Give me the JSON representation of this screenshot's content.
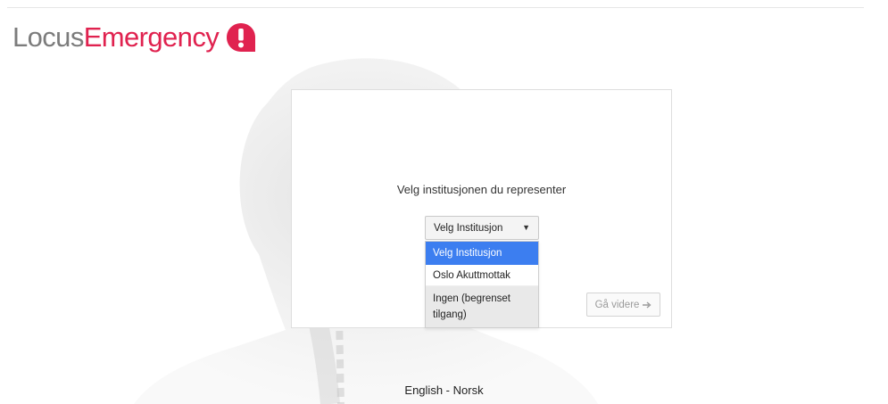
{
  "brand": {
    "part1": "Locus",
    "part2": "Emergency",
    "accent_color": "#e0224f",
    "logo_icon": "exclamation-badge-icon"
  },
  "login": {
    "prompt": "Velg institusjonen du representer",
    "select": {
      "value": "Velg Institusjon",
      "options": [
        {
          "label": "Velg Institusjon"
        },
        {
          "label": "Oslo Akuttmottak"
        },
        {
          "label": "Ingen (begrenset tilgang)"
        }
      ]
    },
    "next_label": "Gå videre",
    "next_icon": "arrow-right-icon"
  },
  "language": {
    "english": "English",
    "separator": "-",
    "norsk": "Norsk"
  },
  "colors": {
    "highlight": "#3c7ef0"
  }
}
